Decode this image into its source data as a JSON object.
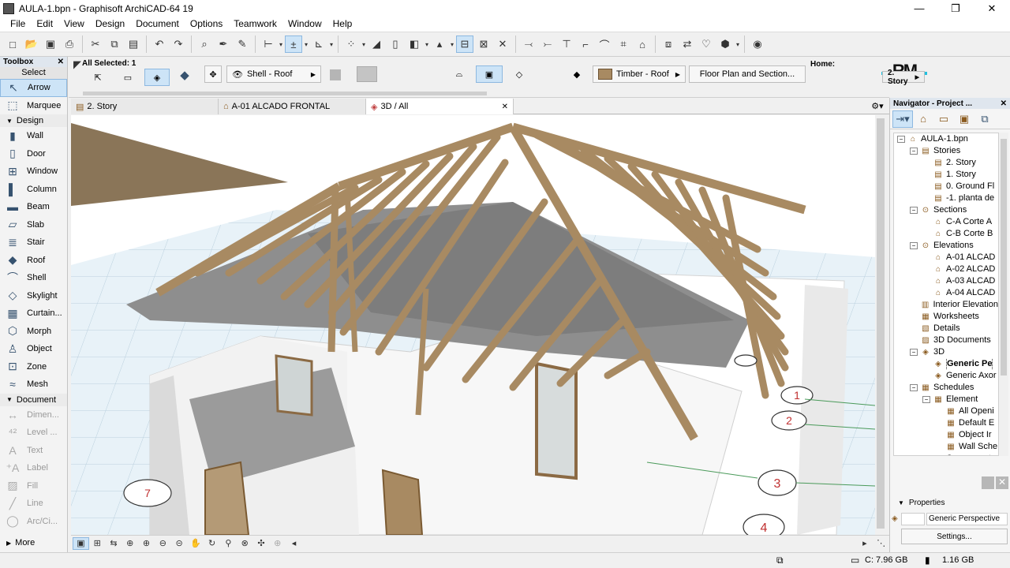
{
  "window": {
    "title": "AULA-1.bpn - Graphisoft ArchiCAD-64 19",
    "minimize": "—",
    "maximize": "❐",
    "close": "✕"
  },
  "menu": [
    "File",
    "Edit",
    "View",
    "Design",
    "Document",
    "Options",
    "Teamwork",
    "Window",
    "Help"
  ],
  "toolbox": {
    "title": "Toolbox",
    "select_label": "Select",
    "arrow_label": "Arrow",
    "marquee_label": "Marquee",
    "design_label": "Design",
    "design_items": [
      {
        "label": "Wall",
        "icon": "▮"
      },
      {
        "label": "Door",
        "icon": "▯"
      },
      {
        "label": "Window",
        "icon": "⊞"
      },
      {
        "label": "Column",
        "icon": "▌"
      },
      {
        "label": "Beam",
        "icon": "▬"
      },
      {
        "label": "Slab",
        "icon": "▱"
      },
      {
        "label": "Stair",
        "icon": "≣"
      },
      {
        "label": "Roof",
        "icon": "◆"
      },
      {
        "label": "Shell",
        "icon": "⌒"
      },
      {
        "label": "Skylight",
        "icon": "◇"
      },
      {
        "label": "Curtain...",
        "icon": "▦"
      },
      {
        "label": "Morph",
        "icon": "⬡"
      },
      {
        "label": "Object",
        "icon": "♙"
      },
      {
        "label": "Zone",
        "icon": "⊡"
      },
      {
        "label": "Mesh",
        "icon": "≈"
      }
    ],
    "document_label": "Document",
    "document_items": [
      {
        "label": "Dimen...",
        "icon": "↔"
      },
      {
        "label": "Level ...",
        "icon": "⁴²"
      },
      {
        "label": "Text",
        "icon": "A"
      },
      {
        "label": "Label",
        "icon": "⁺A"
      },
      {
        "label": "Fill",
        "icon": "▨"
      },
      {
        "label": "Line",
        "icon": "╱"
      },
      {
        "label": "Arc/Ci...",
        "icon": "◯"
      }
    ],
    "more_label": "More"
  },
  "infobox": {
    "all_selected": "All Selected: 1",
    "shell_roof": "Shell - Roof",
    "timber_roof": "Timber - Roof",
    "floor_plan_section": "Floor Plan and Section...",
    "home_label": "Home:",
    "home_value": "2. Story",
    "logo_text": "RM"
  },
  "tabs": [
    {
      "label": "2. Story",
      "icon": "▤"
    },
    {
      "label": "A-01 ALCADO FRONTAL",
      "icon": "⌂"
    },
    {
      "label": "3D / All",
      "icon": "◈"
    }
  ],
  "tab_close": "✕",
  "navigator": {
    "title": "Navigator - Project ...",
    "tree": [
      {
        "label": "AULA-1.bpn",
        "level": 0,
        "tog": "−",
        "icon": "⌂"
      },
      {
        "label": "Stories",
        "level": 1,
        "tog": "−",
        "icon": "▤"
      },
      {
        "label": "2. Story",
        "level": 2,
        "tog": "",
        "icon": "▤"
      },
      {
        "label": "1. Story",
        "level": 2,
        "tog": "",
        "icon": "▤"
      },
      {
        "label": "0. Ground Fl",
        "level": 2,
        "tog": "",
        "icon": "▤"
      },
      {
        "label": "-1. planta de",
        "level": 2,
        "tog": "",
        "icon": "▤"
      },
      {
        "label": "Sections",
        "level": 1,
        "tog": "−",
        "icon": "⊙"
      },
      {
        "label": "C-A Corte A",
        "level": 2,
        "tog": "",
        "icon": "⌂"
      },
      {
        "label": "C-B Corte B",
        "level": 2,
        "tog": "",
        "icon": "⌂"
      },
      {
        "label": "Elevations",
        "level": 1,
        "tog": "−",
        "icon": "⊙"
      },
      {
        "label": "A-01 ALCAD",
        "level": 2,
        "tog": "",
        "icon": "⌂"
      },
      {
        "label": "A-02 ALCAD",
        "level": 2,
        "tog": "",
        "icon": "⌂"
      },
      {
        "label": "A-03 ALCAD",
        "level": 2,
        "tog": "",
        "icon": "⌂"
      },
      {
        "label": "A-04 ALCAD",
        "level": 2,
        "tog": "",
        "icon": "⌂"
      },
      {
        "label": "Interior Elevation",
        "level": 1,
        "tog": "",
        "icon": "▥"
      },
      {
        "label": "Worksheets",
        "level": 1,
        "tog": "",
        "icon": "▦"
      },
      {
        "label": "Details",
        "level": 1,
        "tog": "",
        "icon": "▧"
      },
      {
        "label": "3D Documents",
        "level": 1,
        "tog": "",
        "icon": "▨"
      },
      {
        "label": "3D",
        "level": 1,
        "tog": "−",
        "icon": "◈"
      },
      {
        "label": "Generic Pe",
        "level": 2,
        "tog": "",
        "icon": "◈",
        "selected": true
      },
      {
        "label": "Generic Axor",
        "level": 2,
        "tog": "",
        "icon": "◈"
      },
      {
        "label": "Schedules",
        "level": 1,
        "tog": "−",
        "icon": "▦"
      },
      {
        "label": "Element",
        "level": 2,
        "tog": "−",
        "icon": "▦"
      },
      {
        "label": "All Openi",
        "level": 3,
        "tog": "",
        "icon": "▦"
      },
      {
        "label": "Default E",
        "level": 3,
        "tog": "",
        "icon": "▦"
      },
      {
        "label": "Object Ir",
        "level": 3,
        "tog": "",
        "icon": "▦"
      },
      {
        "label": "Wall Sche",
        "level": 3,
        "tog": "",
        "icon": "▦"
      },
      {
        "label": "Component",
        "level": 2,
        "tog": "",
        "icon": "▦"
      }
    ],
    "properties_label": "Properties",
    "properties_value": "Generic Perspective",
    "settings_label": "Settings..."
  },
  "viewport": {
    "grid_markers": [
      "1",
      "2",
      "3",
      "4",
      "7"
    ]
  },
  "statusbar": {
    "disk_c": "C: 7.96 GB",
    "memory": "1.16 GB"
  },
  "colors": {
    "selection": "#cde4f7",
    "timber": "#a88a62",
    "panel_header": "#dfe6ee"
  }
}
